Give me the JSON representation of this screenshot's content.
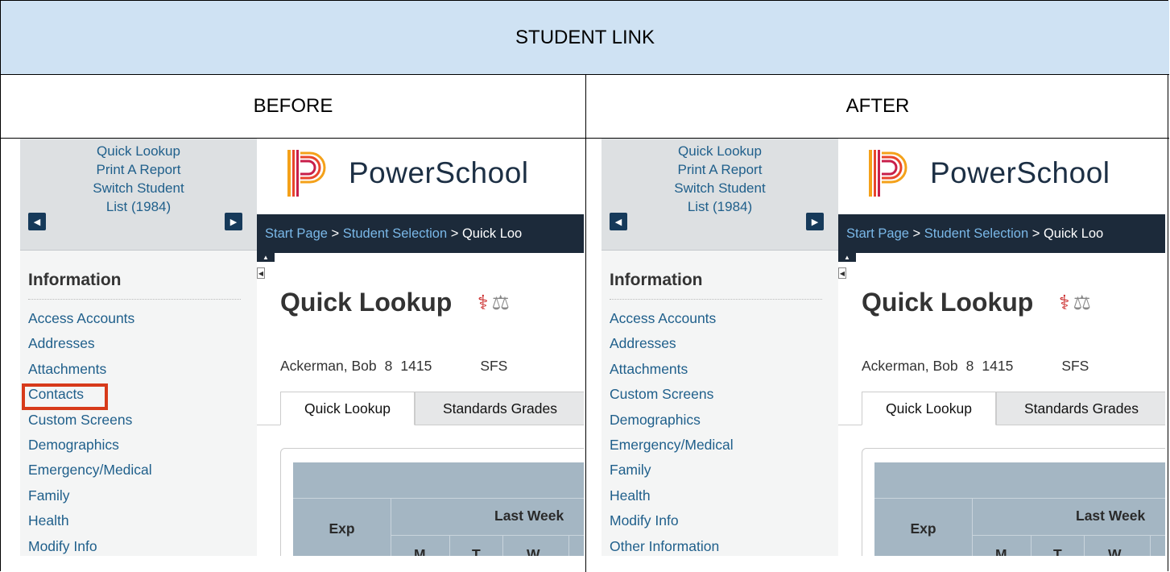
{
  "header": {
    "title": "STUDENT LINK"
  },
  "columns": {
    "before": "BEFORE",
    "after": "AFTER"
  },
  "nav": {
    "links": [
      "Quick Lookup",
      "Print A Report",
      "Switch Student",
      "List (1984)"
    ],
    "prev_icon": "triangle-left-icon",
    "next_icon": "triangle-right-icon"
  },
  "brand": {
    "name": "PowerSchool"
  },
  "breadcrumb": {
    "start": "Start Page",
    "sep1": " > ",
    "selection": "Student Selection",
    "sep2": " > ",
    "current": "Quick Loo"
  },
  "page": {
    "title": "Quick Lookup",
    "alert_icons": [
      "medical-alert-icon",
      "legal-alert-icon"
    ],
    "student": {
      "name": "Ackerman, Bob",
      "grade": "8",
      "id": "1415",
      "school": "SFS"
    },
    "tabs": [
      "Quick Lookup",
      "Standards Grades"
    ]
  },
  "table": {
    "exp": "Exp",
    "last_week": "Last Week",
    "days": [
      "M",
      "T",
      "W"
    ]
  },
  "sidebar": {
    "heading": "Information",
    "before_items": [
      "Access Accounts",
      "Addresses",
      "Attachments",
      "Contacts",
      "Custom Screens",
      "Demographics",
      "Emergency/Medical",
      "Family",
      "Health",
      "Modify Info"
    ],
    "after_items": [
      "Access Accounts",
      "Addresses",
      "Attachments",
      "Custom Screens",
      "Demographics",
      "Emergency/Medical",
      "Family",
      "Health",
      "Modify Info",
      "Other Information"
    ]
  },
  "colors": {
    "header_bg": "#cfe2f3",
    "highlight": "#d73a1a",
    "link": "#1f5f8b",
    "breadcrumb_bg": "#1c2a3a"
  }
}
